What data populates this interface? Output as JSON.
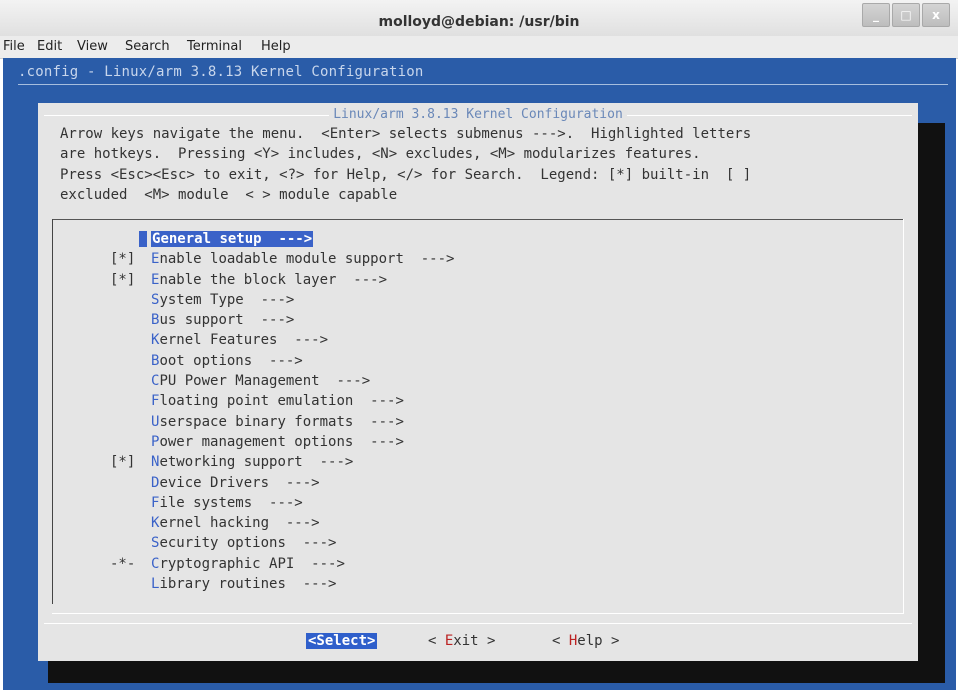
{
  "window": {
    "title": "molloyd@debian: /usr/bin",
    "menu": [
      "File",
      "Edit",
      "View",
      "Search",
      "Terminal",
      "Help"
    ]
  },
  "terminal": {
    "config_line": ".config - Linux/arm 3.8.13 Kernel Configuration",
    "dialog_title": "Linux/arm 3.8.13 Kernel Configuration",
    "help_lines": [
      "Arrow keys navigate the menu.  <Enter> selects submenus --->.  Highlighted letters",
      "are hotkeys.  Pressing <Y> includes, <N> excludes, <M> modularizes features.",
      "Press <Esc><Esc> to exit, <?> for Help, </> for Search.  Legend: [*] built-in  [ ]",
      "excluded  <M> module  < > module capable"
    ],
    "menu_items": [
      {
        "prefix": "",
        "hotkey": "G",
        "rest": "eneral setup  --->",
        "selected": true
      },
      {
        "prefix": "[*]",
        "hotkey": "E",
        "rest": "nable loadable module support  --->"
      },
      {
        "prefix": "[*]",
        "hotkey": "E",
        "rest": "nable the block layer  --->"
      },
      {
        "prefix": "",
        "hotkey": "S",
        "rest": "ystem Type  --->"
      },
      {
        "prefix": "",
        "hotkey": "B",
        "rest": "us support  --->"
      },
      {
        "prefix": "",
        "hotkey": "K",
        "rest": "ernel Features  --->"
      },
      {
        "prefix": "",
        "hotkey": "B",
        "rest": "oot options  --->"
      },
      {
        "prefix": "",
        "hotkey": "C",
        "rest": "PU Power Management  --->"
      },
      {
        "prefix": "",
        "hotkey": "F",
        "rest": "loating point emulation  --->"
      },
      {
        "prefix": "",
        "hotkey": "U",
        "rest": "serspace binary formats  --->"
      },
      {
        "prefix": "",
        "hotkey": "P",
        "rest": "ower management options  --->"
      },
      {
        "prefix": "[*]",
        "hotkey": "N",
        "rest": "etworking support  --->"
      },
      {
        "prefix": "",
        "hotkey": "D",
        "rest": "evice Drivers  --->"
      },
      {
        "prefix": "",
        "hotkey": "F",
        "rest": "ile systems  --->"
      },
      {
        "prefix": "",
        "hotkey": "K",
        "rest": "ernel hacking  --->"
      },
      {
        "prefix": "",
        "hotkey": "S",
        "rest": "ecurity options  --->"
      },
      {
        "prefix": "-*-",
        "hotkey": "C",
        "rest": "ryptographic API  --->"
      },
      {
        "prefix": "",
        "hotkey": "L",
        "rest": "ibrary routines  --->"
      }
    ],
    "buttons": {
      "select": "<Select>",
      "exit_pre": "< ",
      "exit_hot": "E",
      "exit_post": "xit >",
      "help_pre": "< ",
      "help_hot": "H",
      "help_post": "elp >"
    }
  }
}
